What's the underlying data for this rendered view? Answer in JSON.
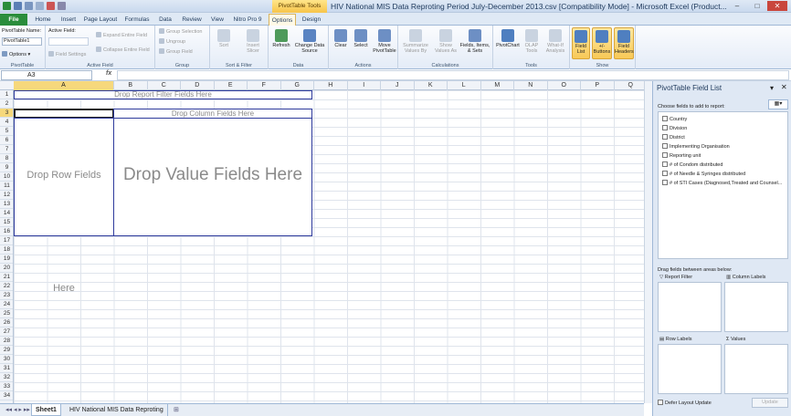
{
  "window": {
    "title": "HIV National MIS Data Reproting Period July-December 2013.csv  [Compatibility Mode] - Microsoft Excel (Product...",
    "context_header": "PivotTable Tools",
    "min": "–",
    "max": "□",
    "close": "✕"
  },
  "tabs": [
    "File",
    "Home",
    "Insert",
    "Page Layout",
    "Formulas",
    "Data",
    "Review",
    "View",
    "Nitro Pro 9",
    "Options",
    "Design"
  ],
  "ribbon": {
    "pivottable": {
      "name_label": "PivotTable Name:",
      "name_value": "PivotTable1",
      "options": "Options",
      "group": "PivotTable"
    },
    "active_field": {
      "label": "Active Field:",
      "field_settings": "Field Settings",
      "expand": "Expand Entire Field",
      "collapse": "Collapse Entire Field",
      "group": "Active Field"
    },
    "group": {
      "selection": "Group Selection",
      "ungroup": "Ungroup",
      "field": "Group Field",
      "group": "Group"
    },
    "sort_filter": {
      "sort": "Sort",
      "insert_slicer": "Insert Slicer",
      "group": "Sort & Filter"
    },
    "data": {
      "refresh": "Refresh",
      "change_source": "Change Data Source",
      "group": "Data"
    },
    "actions": {
      "clear": "Clear",
      "select": "Select",
      "move": "Move PivotTable",
      "group": "Actions"
    },
    "calculations": {
      "summarize": "Summarize Values By",
      "show_as": "Show Values As",
      "fields_items": "Fields, Items, & Sets",
      "group": "Calculations"
    },
    "tools": {
      "pivotchart": "PivotChart",
      "olap": "OLAP Tools",
      "whatif": "What-If Analysis",
      "group": "Tools"
    },
    "show": {
      "field_list": "Field List",
      "buttons": "+/- Buttons",
      "headers": "Field Headers",
      "group": "Show"
    }
  },
  "formula_bar": {
    "name_box": "A3",
    "fx": "fx",
    "value": ""
  },
  "columns": [
    "A",
    "B",
    "C",
    "D",
    "E",
    "F",
    "G",
    "H",
    "I",
    "J",
    "K",
    "L",
    "M",
    "N",
    "O",
    "P",
    "Q"
  ],
  "rows": [
    "1",
    "2",
    "3",
    "4",
    "5",
    "6",
    "7",
    "8",
    "9",
    "10",
    "11",
    "12",
    "13",
    "14",
    "15",
    "16",
    "17",
    "18",
    "19",
    "20",
    "21",
    "22",
    "23",
    "24",
    "25",
    "26",
    "27",
    "28",
    "29",
    "30",
    "31",
    "32",
    "33",
    "34"
  ],
  "pivot": {
    "report_filter": "Drop Report Filter Fields Here",
    "column_fields": "Drop Column Fields Here",
    "row_fields": "Drop Row Fields Here",
    "value_fields": "Drop Value Fields Here"
  },
  "sheets": {
    "active": "Sheet1",
    "other": "HIV National MIS Data Reproting"
  },
  "field_list": {
    "title": "PivotTable Field List",
    "choose_label": "Choose fields to add to report:",
    "fields": [
      "Country",
      "Division",
      "District",
      "Implementing Organisation",
      "Reporting unit",
      "# of Condom distributed",
      "# of Needle & Syringes distributed",
      "# of STI Cases (Diagnosed,Treated and Counsel..."
    ],
    "drag_label": "Drag fields between areas below:",
    "report_filter": "Report Filter",
    "column_labels": "Column Labels",
    "row_labels": "Row Labels",
    "values": "Values",
    "defer": "Defer Layout Update",
    "update": "Update"
  }
}
